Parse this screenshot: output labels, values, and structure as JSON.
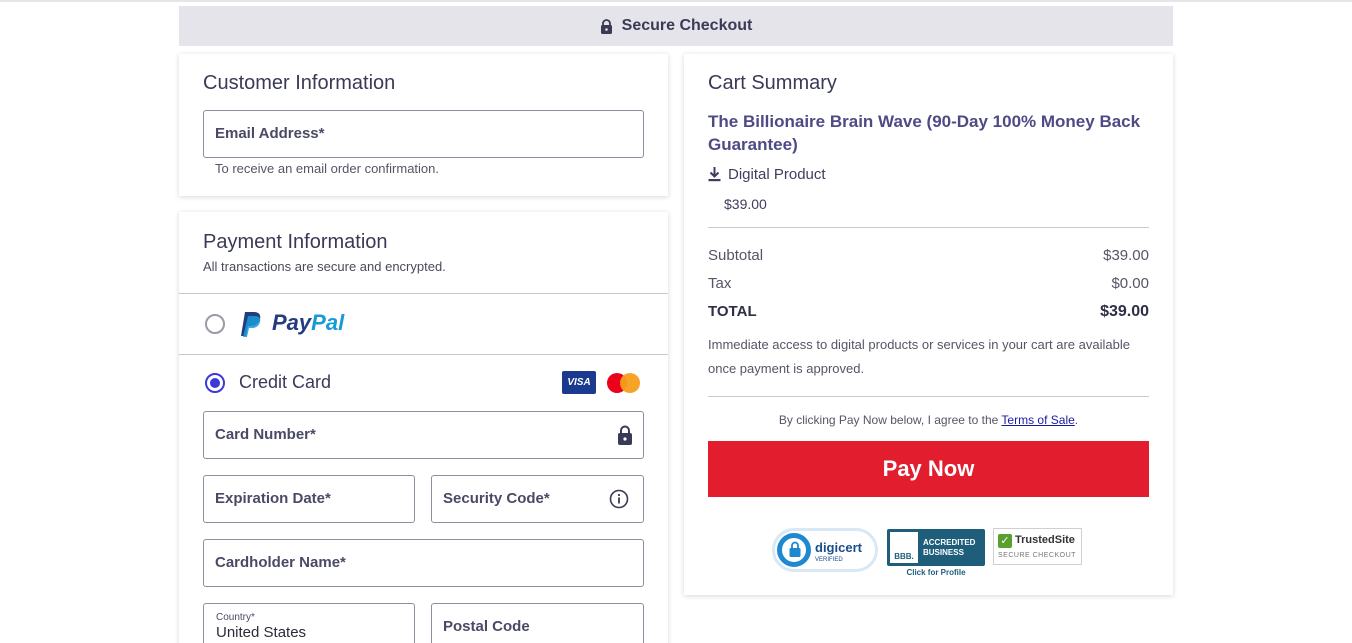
{
  "header": {
    "title": "Secure Checkout",
    "icon": "lock-icon"
  },
  "customer": {
    "title": "Customer Information",
    "email_label": "Email Address*",
    "email_helper": "To receive an email order confirmation."
  },
  "payment": {
    "title": "Payment Information",
    "subtitle": "All transactions are secure and encrypted.",
    "paypal": {
      "pay": "Pay",
      "pal": "Pal",
      "selected": false
    },
    "credit_card": {
      "label": "Credit Card",
      "selected": true,
      "visa_text": "VISA",
      "card_number_label": "Card Number*",
      "expiration_label": "Expiration Date*",
      "security_label": "Security Code*",
      "cardholder_label": "Cardholder Name*",
      "country_label": "Country*",
      "country_value": "United States",
      "postal_label": "Postal Code"
    }
  },
  "summary": {
    "title": "Cart Summary",
    "product_name": "The Billionaire Brain Wave (90-Day 100% Money Back Guarantee)",
    "product_type": "Digital Product",
    "product_price": "$39.00",
    "subtotal_label": "Subtotal",
    "subtotal_value": "$39.00",
    "tax_label": "Tax",
    "tax_value": "$0.00",
    "total_label": "TOTAL",
    "total_value": "$39.00",
    "access_note": "Immediate access to digital products or services in your cart are available once payment is approved.",
    "agree_prefix": "By clicking Pay Now below, I agree to the ",
    "agree_link": "Terms of Sale",
    "agree_suffix": ".",
    "pay_button": "Pay Now"
  },
  "badges": {
    "digicert": "digicert",
    "digicert_sub": "VERIFIED",
    "bbb_logo": "BBB.",
    "bbb_line1": "ACCREDITED",
    "bbb_line2": "BUSINESS",
    "bbb_link": "Click for Profile",
    "trustedsite": "TrustedSite",
    "trustedsite_sub": "SECURE CHECKOUT"
  },
  "colors": {
    "accent": "#3b3bd6",
    "pay_button": "#e11d2e",
    "paypal_dark": "#253b80",
    "paypal_light": "#179bd7"
  }
}
